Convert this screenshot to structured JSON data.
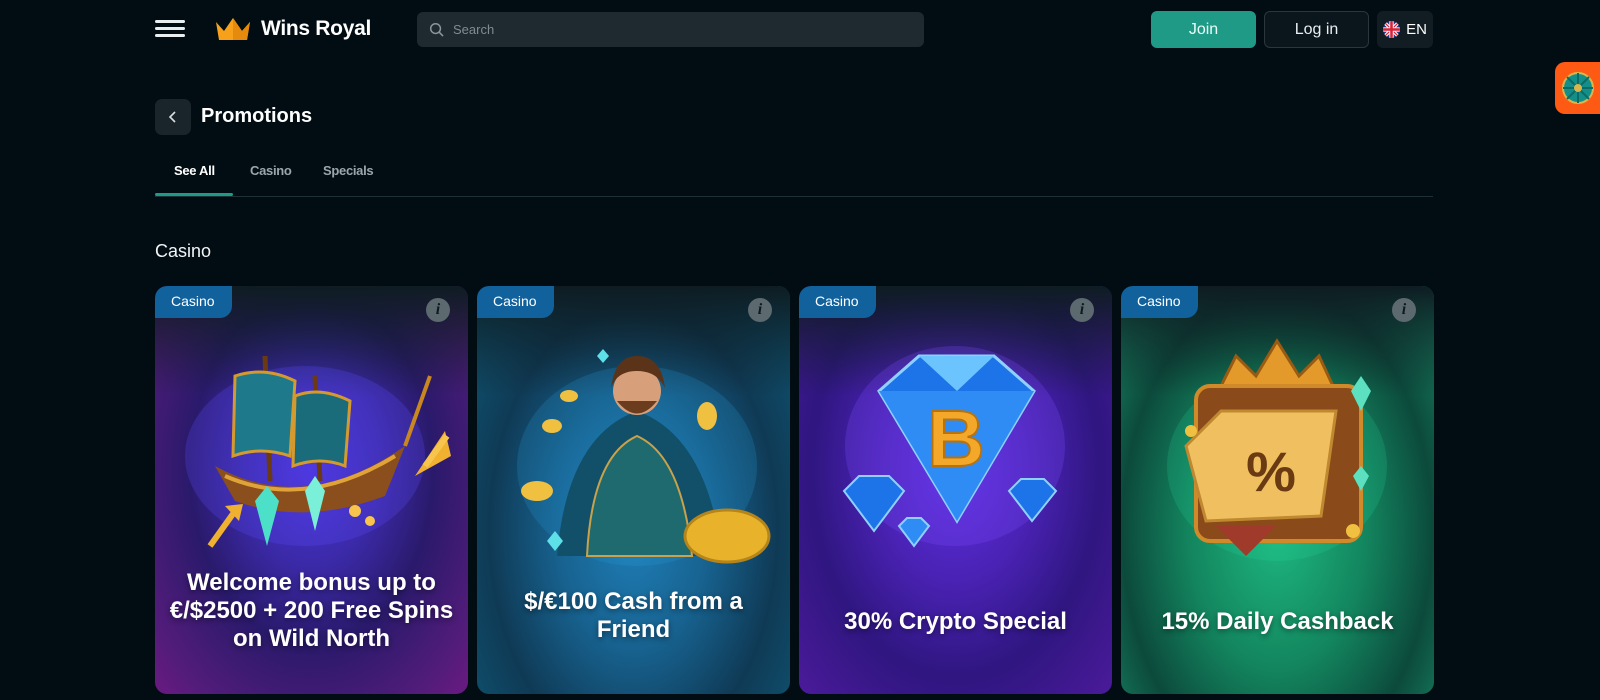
{
  "header": {
    "logo_text": "Wins Royal",
    "search_placeholder": "Search",
    "join_label": "Join",
    "login_label": "Log in",
    "language": "EN"
  },
  "page": {
    "title": "Promotions"
  },
  "tabs": [
    {
      "label": "See All",
      "active": true
    },
    {
      "label": "Casino",
      "active": false
    },
    {
      "label": "Specials",
      "active": false
    }
  ],
  "section": {
    "title": "Casino"
  },
  "cards": [
    {
      "badge": "Casino",
      "info": "i",
      "title": "Welcome bonus up to €/$2500 + 200 Free Spins on Wild North",
      "icon": "pirate-ship-illustration"
    },
    {
      "badge": "Casino",
      "info": "i",
      "title": "$/€100 Cash from a Friend",
      "icon": "mage-with-coins-illustration"
    },
    {
      "badge": "Casino",
      "info": "i",
      "title": "30% Crypto Special",
      "icon": "bitcoin-diamond-illustration"
    },
    {
      "badge": "Casino",
      "info": "i",
      "title": "15% Daily Cashback",
      "icon": "treasure-percent-illustration"
    }
  ],
  "colors": {
    "background": "#020d13",
    "accent": "#1f9a86",
    "badge": "#11619c",
    "side_widget": "#ff5a14"
  }
}
